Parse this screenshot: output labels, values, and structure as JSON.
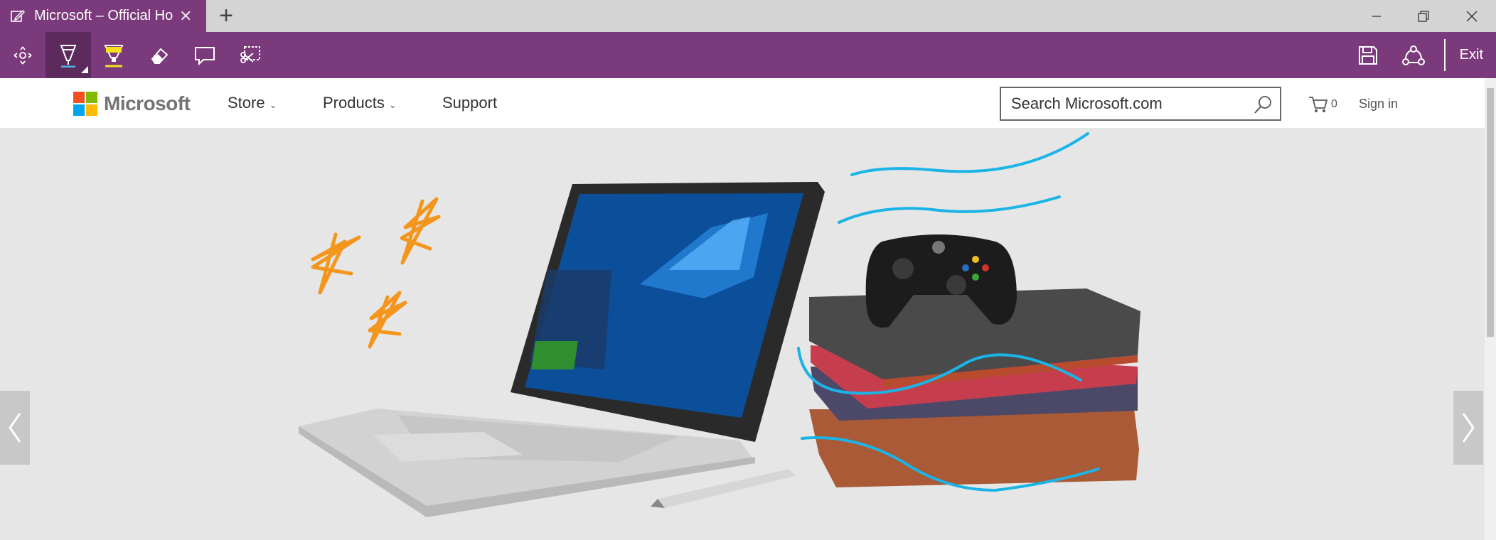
{
  "window": {
    "tab_title": "Microsoft – Official Hon",
    "new_tab": "+"
  },
  "ink_toolbar": {
    "tools": [
      "pan-tool",
      "ballpoint-pen",
      "highlighter",
      "eraser",
      "add-note",
      "clip"
    ],
    "exit_label": "Exit"
  },
  "site": {
    "brand": "Microsoft",
    "nav": {
      "store": "Store",
      "products": "Products",
      "support": "Support"
    },
    "search_placeholder": "Search Microsoft.com",
    "cart_count": "0",
    "sign_in": "Sign in"
  },
  "colors": {
    "ink_accent": "#7b3a7b",
    "ink_orange": "#f5961c",
    "ink_blue": "#1ab4e6"
  }
}
